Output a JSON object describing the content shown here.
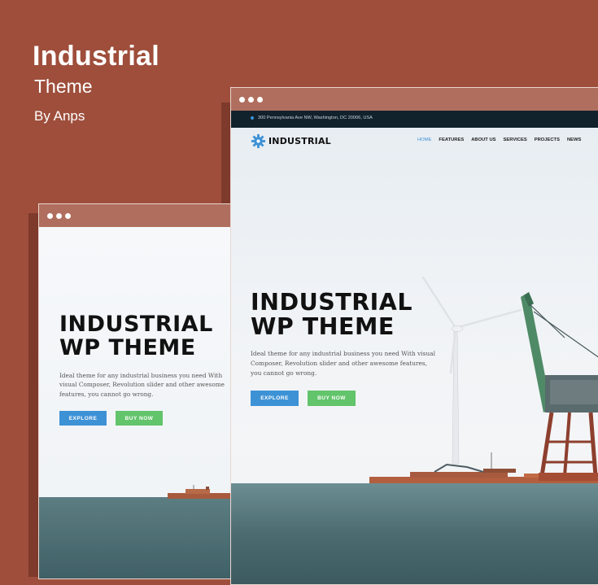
{
  "brand": {
    "title": "Industrial",
    "subtitle": "Theme",
    "by": "By Anps"
  },
  "hero": {
    "line1": "INDUSTRIAL",
    "line2": "WP THEME",
    "description": "Ideal theme for any industrial business you need With visual Composer, Revolution slider and other awesome features, you cannot go wrong.",
    "explore_label": "EXPLORE",
    "buy_label": "BUY NOW"
  },
  "site": {
    "address": "300 Pennsylvania Ave NW, Washington, DC 20006, USA",
    "logo_text": "INDUSTRIAL",
    "nav": [
      "HOME",
      "FEATURES",
      "ABOUT US",
      "SERVICES",
      "PROJECTS",
      "NEWS"
    ]
  },
  "colors": {
    "background": "#9e4e3b",
    "window_bar": "#b06e5e",
    "explore": "#3d92d6",
    "buy": "#62c46b"
  }
}
